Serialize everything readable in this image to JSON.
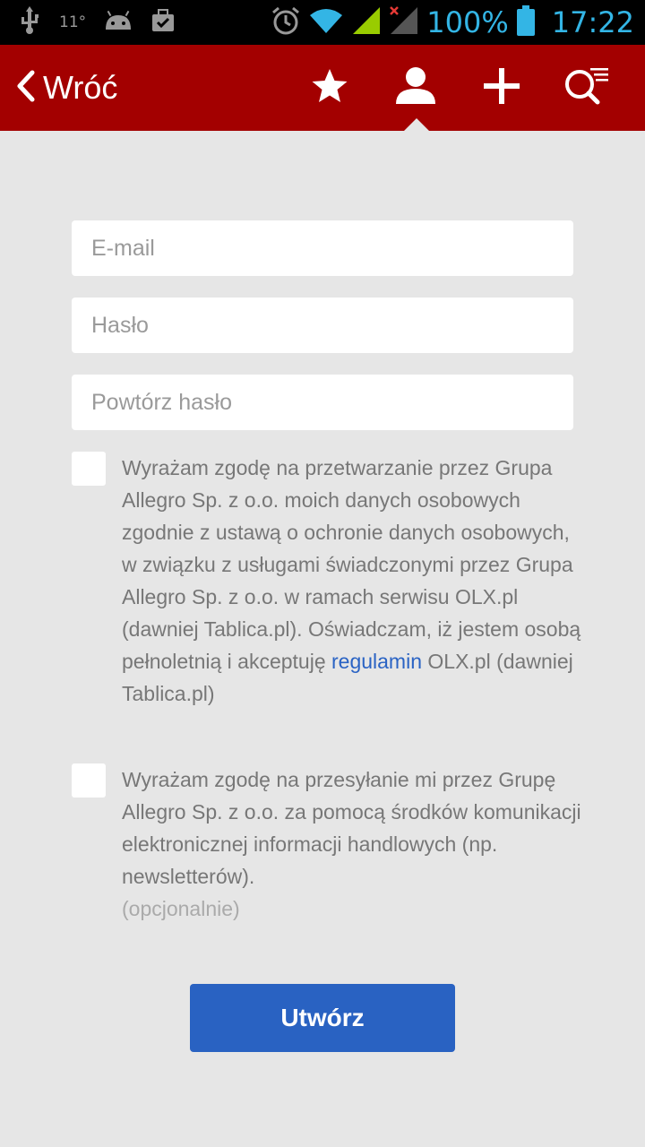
{
  "status_bar": {
    "temperature": "11°",
    "battery_percent": "100%",
    "time": "17:22",
    "icons": [
      "usb-icon",
      "android-icon",
      "briefcase-check-icon",
      "alarm-icon",
      "wifi-icon",
      "signal-icon",
      "signal-disabled-icon",
      "battery-icon"
    ]
  },
  "appbar": {
    "back_label": "Wróć",
    "icons": [
      "star-icon",
      "user-icon",
      "plus-icon",
      "search-menu-icon"
    ],
    "active_icon": "user-icon",
    "color": "#a30000"
  },
  "form": {
    "email_placeholder": "E-mail",
    "password_placeholder": "Hasło",
    "repeat_password_placeholder": "Powtórz hasło"
  },
  "consent1": {
    "text_before": "Wyrażam zgodę na przetwarzanie przez Grupa Allegro Sp. z o.o. moich danych osobowych zgodnie z ustawą o ochronie danych osobowych, w związku z usługami świadczonymi przez Grupa Allegro Sp. z o.o. w ramach serwisu OLX.pl (dawniej Tablica.pl). Oświadczam, iż jestem osobą pełnoletnią i akceptuję ",
    "link": "regulamin",
    "text_after": " OLX.pl (dawniej Tablica.pl)",
    "checked": false
  },
  "consent2": {
    "text": "Wyrażam zgodę na przesyłanie mi przez Grupę Allegro Sp. z o.o. za pomocą środków komunikacji elektronicznej informacji handlowych (np. newsletterów).",
    "optional": "(opcjonalnie)",
    "checked": false
  },
  "submit_label": "Utwórz",
  "colors": {
    "link": "#2a63c4",
    "button": "#2962c2",
    "background": "#e6e6e6"
  }
}
